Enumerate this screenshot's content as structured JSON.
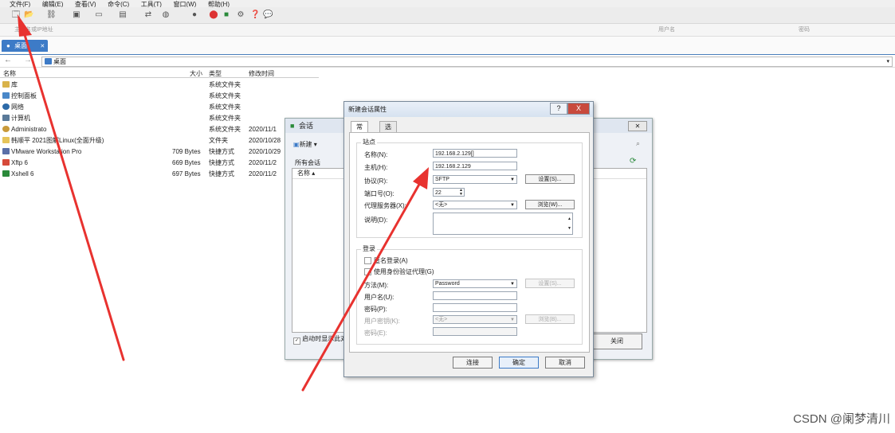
{
  "menu": [
    "文件(F)",
    "编辑(E)",
    "查看(V)",
    "命令(C)",
    "工具(T)",
    "窗口(W)",
    "帮助(H)"
  ],
  "address_bar": {
    "host_placeholder": "主机名或IP地址",
    "user_placeholder": "用户名",
    "password_placeholder": "密码"
  },
  "tab": {
    "label": "桌面"
  },
  "nav": {
    "path": "桌面"
  },
  "file_list": {
    "headers": {
      "name": "名称",
      "size": "大小",
      "type": "类型",
      "modified": "修改时间"
    },
    "rows": [
      {
        "name": "库",
        "size": "",
        "type": "系统文件夹",
        "modified": ""
      },
      {
        "name": "控制面板",
        "size": "",
        "type": "系统文件夹",
        "modified": ""
      },
      {
        "name": "网络",
        "size": "",
        "type": "系统文件夹",
        "modified": ""
      },
      {
        "name": "计算机",
        "size": "",
        "type": "系统文件夹",
        "modified": ""
      },
      {
        "name": "Administrato",
        "size": "",
        "type": "系统文件夹",
        "modified": "2020/11/1"
      },
      {
        "name": "韩顺平 2021图解Linux(全面升级)",
        "size": "",
        "type": "文件夹",
        "modified": "2020/10/28"
      },
      {
        "name": "VMware Workstation Pro",
        "size": "709 Bytes",
        "type": "快捷方式",
        "modified": "2020/10/29"
      },
      {
        "name": "Xftp 6",
        "size": "669 Bytes",
        "type": "快捷方式",
        "modified": "2020/11/2"
      },
      {
        "name": "Xshell 6",
        "size": "697 Bytes",
        "type": "快捷方式",
        "modified": "2020/11/2"
      }
    ]
  },
  "sessions_window": {
    "title": "会话",
    "new_button": "新建",
    "all_sessions": "所有会话",
    "column_name": "名称",
    "startup_checkbox": "启动时显示此对话框",
    "close_button": "关闭"
  },
  "dialog": {
    "title": "新建会话属性",
    "help": "?",
    "close": "X",
    "tabs": [
      "常规",
      "选项"
    ],
    "site_group": "站点",
    "name_label": "名称(N):",
    "name_value": "192.168.2.129[]",
    "host_label": "主机(H):",
    "host_value": "192.168.2.129",
    "protocol_label": "协议(R):",
    "protocol_value": "SFTP",
    "settings_button": "设置(S)...",
    "port_label": "端口号(O):",
    "port_value": "22",
    "proxy_label": "代理服务器(X):",
    "proxy_value": "<无>",
    "browse_button": "浏览(W)...",
    "desc_label": "说明(D):",
    "login_group": "登录",
    "anon_login": "匿名登录(A)",
    "agent_auth": "使用身份验证代理(G)",
    "method_label": "方法(M):",
    "method_value": "Password",
    "method_settings": "设置(S)...",
    "user_label": "用户名(U):",
    "pass_label": "密码(P):",
    "userkey_label": "用户密钥(K):",
    "userkey_value": "<无>",
    "userkey_browse": "浏览(B)...",
    "passphrase_label": "密码(E):",
    "connect_button": "连接",
    "ok_button": "确定",
    "cancel_button": "取消"
  },
  "footer": "CSDN @阑梦清川",
  "colors": {
    "accent": "#3d7bc7",
    "arrow": "#e8322f"
  }
}
